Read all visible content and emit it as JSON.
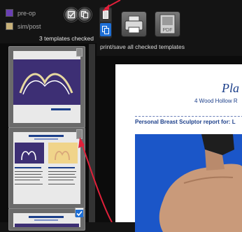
{
  "legend": [
    {
      "label": "pre-op",
      "color": "#6a3fb5"
    },
    {
      "label": "sim/post",
      "color": "#c9b27a"
    }
  ],
  "templates": {
    "checked_count_text": "3 templates checked"
  },
  "toolbar": {
    "print_icon": "printer-icon",
    "pdf_label": "PDF",
    "caption": "print/save all checked templates"
  },
  "preview": {
    "title": "Pla",
    "address": "4 Wood Hollow R",
    "report_line": "Personal Breast Sculptor report for: L"
  },
  "colors": {
    "accent_blue": "#1e6fd6",
    "doc_blue": "#1c3f8a",
    "annotation_red": "#e0203a"
  }
}
